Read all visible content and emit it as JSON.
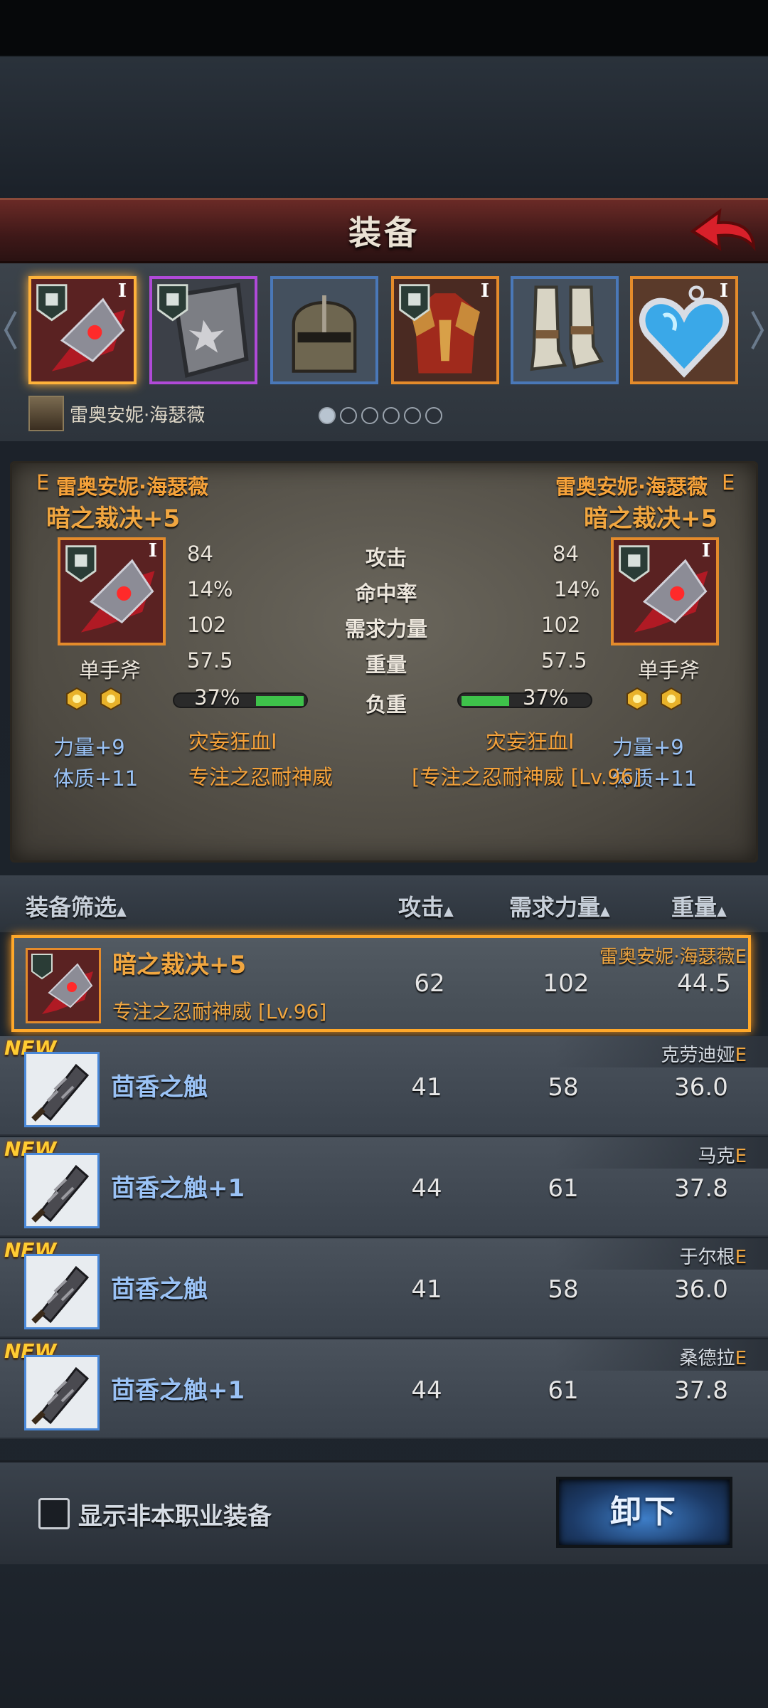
{
  "header": {
    "title": "装备"
  },
  "slots": {
    "character_name": "雷奥安妮·海瑟薇",
    "tier_mark": "I",
    "page_count": 6,
    "page_index": 0
  },
  "compare": {
    "left": {
      "rank": "E",
      "owner": "雷奥安妮·海瑟薇",
      "item_name": "暗之裁决+5",
      "type": "单手斧",
      "attack": "84",
      "accuracy": "14%",
      "str_req": "102",
      "weight": "57.5",
      "load": "37%",
      "load_fraction": 0.37,
      "perk": "灾妄狂血I",
      "trait": "专注之忍耐神威",
      "bonus1": "力量+9",
      "bonus2": "体质+11"
    },
    "right": {
      "rank": "E",
      "owner": "雷奥安妮·海瑟薇",
      "item_name": "暗之裁决+5",
      "type": "单手斧",
      "attack": "84",
      "accuracy": "14%",
      "str_req": "102",
      "weight": "57.5",
      "load": "37%",
      "load_fraction": 0.37,
      "perk": "灾妄狂血I",
      "trait": "[专注之忍耐神威 [Lv.96]",
      "bonus1": "力量+9",
      "bonus2": "体质+11"
    },
    "labels": {
      "attack": "攻击",
      "accuracy": "命中率",
      "str_req": "需求力量",
      "weight": "重量",
      "load": "负重"
    }
  },
  "list": {
    "headers": {
      "filter": "装备筛选",
      "attack": "攻击",
      "str_req": "需求力量",
      "weight": "重量"
    },
    "new_label": "NEW",
    "rank_label": "E",
    "rows": [
      {
        "name": "暗之裁决+5",
        "sub": "专注之忍耐神威 [Lv.96]",
        "attack": "62",
        "str_req": "102",
        "weight": "44.5",
        "owner": "雷奥安妮·海瑟薇"
      },
      {
        "name": "茴香之触",
        "attack": "41",
        "str_req": "58",
        "weight": "36.0",
        "owner": "克劳迪娅"
      },
      {
        "name": "茴香之触+1",
        "attack": "44",
        "str_req": "61",
        "weight": "37.8",
        "owner": "马克"
      },
      {
        "name": "茴香之触",
        "attack": "41",
        "str_req": "58",
        "weight": "36.0",
        "owner": "于尔根"
      },
      {
        "name": "茴香之触+1",
        "attack": "44",
        "str_req": "61",
        "weight": "37.8",
        "owner": "桑德拉"
      }
    ]
  },
  "bottom": {
    "checkbox_label": "显示非本职业装备",
    "unequip_label": "卸下"
  }
}
